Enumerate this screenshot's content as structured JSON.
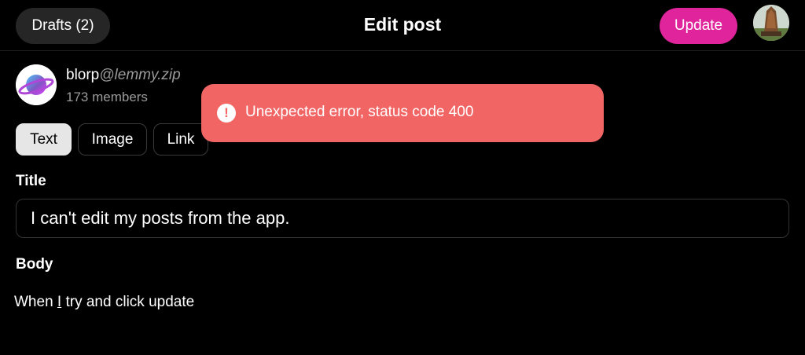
{
  "header": {
    "drafts_label": "Drafts (2)",
    "title": "Edit post",
    "update_label": "Update"
  },
  "community": {
    "name": "blorp",
    "instance": "@lemmy.zip",
    "members": "173 members"
  },
  "tabs": [
    {
      "label": "Text",
      "active": true
    },
    {
      "label": "Image",
      "active": false
    },
    {
      "label": "Link",
      "active": false
    }
  ],
  "form": {
    "title_label": "Title",
    "title_value": "I can't edit my posts from the app.",
    "body_label": "Body",
    "body_before": "When ",
    "body_underlined": "I",
    "body_after": " try and click update"
  },
  "toast": {
    "icon": "exclamation-icon",
    "message": "Unexpected error, status code 400"
  },
  "colors": {
    "accent": "#e0249c",
    "error": "#f26565",
    "background": "#000000"
  }
}
